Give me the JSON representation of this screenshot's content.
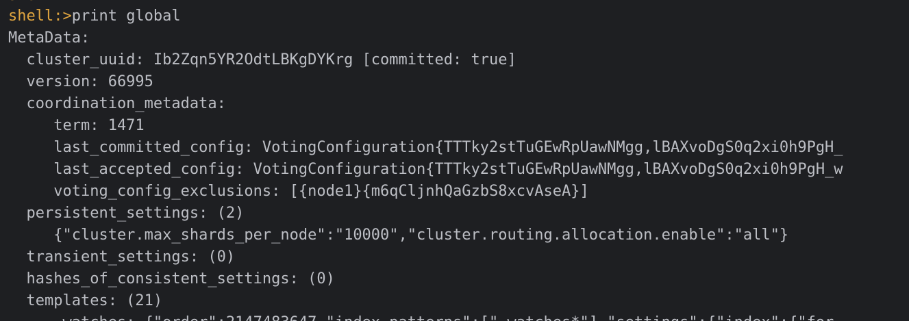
{
  "terminal": {
    "partial_top": "shell:",
    "prompt": "shell:>",
    "command": "print global",
    "lines": [
      "MetaData:",
      "  cluster_uuid: Ib2Zqn5YR2OdtLBKgDYKrg [committed: true]",
      "  version: 66995",
      "  coordination_metadata:",
      "     term: 1471",
      "     last_committed_config: VotingConfiguration{TTTky2stTuGEwRpUawNMgg,lBAXvoDgS0q2xi0h9PgH_",
      "     last_accepted_config: VotingConfiguration{TTTky2stTuGEwRpUawNMgg,lBAXvoDgS0q2xi0h9PgH_w",
      "     voting_config_exclusions: [{node1}{m6qCljnhQaGzbS8xcvAseA}]",
      "  persistent_settings: (2)",
      "     {\"cluster.max_shards_per_node\":\"10000\",\"cluster.routing.allocation.enable\":\"all\"}",
      "  transient_settings: (0)",
      "  hashes_of_consistent_settings: (0)",
      "  templates: (21)"
    ],
    "partial_bottom": "     .watches: {\"order\":2147483647,\"index_patterns\":[\".watches*\"],\"settings\":{\"index\":{\"for"
  }
}
